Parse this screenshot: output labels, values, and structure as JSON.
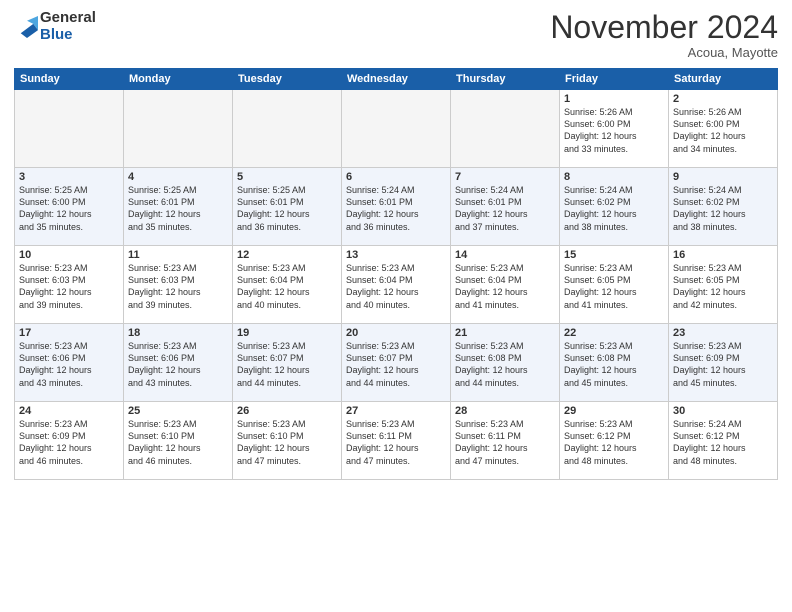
{
  "logo": {
    "general": "General",
    "blue": "Blue"
  },
  "header": {
    "month": "November 2024",
    "location": "Acoua, Mayotte"
  },
  "weekdays": [
    "Sunday",
    "Monday",
    "Tuesday",
    "Wednesday",
    "Thursday",
    "Friday",
    "Saturday"
  ],
  "weeks": [
    [
      {
        "day": "",
        "info": ""
      },
      {
        "day": "",
        "info": ""
      },
      {
        "day": "",
        "info": ""
      },
      {
        "day": "",
        "info": ""
      },
      {
        "day": "",
        "info": ""
      },
      {
        "day": "1",
        "info": "Sunrise: 5:26 AM\nSunset: 6:00 PM\nDaylight: 12 hours\nand 33 minutes."
      },
      {
        "day": "2",
        "info": "Sunrise: 5:26 AM\nSunset: 6:00 PM\nDaylight: 12 hours\nand 34 minutes."
      }
    ],
    [
      {
        "day": "3",
        "info": "Sunrise: 5:25 AM\nSunset: 6:00 PM\nDaylight: 12 hours\nand 35 minutes."
      },
      {
        "day": "4",
        "info": "Sunrise: 5:25 AM\nSunset: 6:01 PM\nDaylight: 12 hours\nand 35 minutes."
      },
      {
        "day": "5",
        "info": "Sunrise: 5:25 AM\nSunset: 6:01 PM\nDaylight: 12 hours\nand 36 minutes."
      },
      {
        "day": "6",
        "info": "Sunrise: 5:24 AM\nSunset: 6:01 PM\nDaylight: 12 hours\nand 36 minutes."
      },
      {
        "day": "7",
        "info": "Sunrise: 5:24 AM\nSunset: 6:01 PM\nDaylight: 12 hours\nand 37 minutes."
      },
      {
        "day": "8",
        "info": "Sunrise: 5:24 AM\nSunset: 6:02 PM\nDaylight: 12 hours\nand 38 minutes."
      },
      {
        "day": "9",
        "info": "Sunrise: 5:24 AM\nSunset: 6:02 PM\nDaylight: 12 hours\nand 38 minutes."
      }
    ],
    [
      {
        "day": "10",
        "info": "Sunrise: 5:23 AM\nSunset: 6:03 PM\nDaylight: 12 hours\nand 39 minutes."
      },
      {
        "day": "11",
        "info": "Sunrise: 5:23 AM\nSunset: 6:03 PM\nDaylight: 12 hours\nand 39 minutes."
      },
      {
        "day": "12",
        "info": "Sunrise: 5:23 AM\nSunset: 6:04 PM\nDaylight: 12 hours\nand 40 minutes."
      },
      {
        "day": "13",
        "info": "Sunrise: 5:23 AM\nSunset: 6:04 PM\nDaylight: 12 hours\nand 40 minutes."
      },
      {
        "day": "14",
        "info": "Sunrise: 5:23 AM\nSunset: 6:04 PM\nDaylight: 12 hours\nand 41 minutes."
      },
      {
        "day": "15",
        "info": "Sunrise: 5:23 AM\nSunset: 6:05 PM\nDaylight: 12 hours\nand 41 minutes."
      },
      {
        "day": "16",
        "info": "Sunrise: 5:23 AM\nSunset: 6:05 PM\nDaylight: 12 hours\nand 42 minutes."
      }
    ],
    [
      {
        "day": "17",
        "info": "Sunrise: 5:23 AM\nSunset: 6:06 PM\nDaylight: 12 hours\nand 43 minutes."
      },
      {
        "day": "18",
        "info": "Sunrise: 5:23 AM\nSunset: 6:06 PM\nDaylight: 12 hours\nand 43 minutes."
      },
      {
        "day": "19",
        "info": "Sunrise: 5:23 AM\nSunset: 6:07 PM\nDaylight: 12 hours\nand 44 minutes."
      },
      {
        "day": "20",
        "info": "Sunrise: 5:23 AM\nSunset: 6:07 PM\nDaylight: 12 hours\nand 44 minutes."
      },
      {
        "day": "21",
        "info": "Sunrise: 5:23 AM\nSunset: 6:08 PM\nDaylight: 12 hours\nand 44 minutes."
      },
      {
        "day": "22",
        "info": "Sunrise: 5:23 AM\nSunset: 6:08 PM\nDaylight: 12 hours\nand 45 minutes."
      },
      {
        "day": "23",
        "info": "Sunrise: 5:23 AM\nSunset: 6:09 PM\nDaylight: 12 hours\nand 45 minutes."
      }
    ],
    [
      {
        "day": "24",
        "info": "Sunrise: 5:23 AM\nSunset: 6:09 PM\nDaylight: 12 hours\nand 46 minutes."
      },
      {
        "day": "25",
        "info": "Sunrise: 5:23 AM\nSunset: 6:10 PM\nDaylight: 12 hours\nand 46 minutes."
      },
      {
        "day": "26",
        "info": "Sunrise: 5:23 AM\nSunset: 6:10 PM\nDaylight: 12 hours\nand 47 minutes."
      },
      {
        "day": "27",
        "info": "Sunrise: 5:23 AM\nSunset: 6:11 PM\nDaylight: 12 hours\nand 47 minutes."
      },
      {
        "day": "28",
        "info": "Sunrise: 5:23 AM\nSunset: 6:11 PM\nDaylight: 12 hours\nand 47 minutes."
      },
      {
        "day": "29",
        "info": "Sunrise: 5:23 AM\nSunset: 6:12 PM\nDaylight: 12 hours\nand 48 minutes."
      },
      {
        "day": "30",
        "info": "Sunrise: 5:24 AM\nSunset: 6:12 PM\nDaylight: 12 hours\nand 48 minutes."
      }
    ]
  ]
}
